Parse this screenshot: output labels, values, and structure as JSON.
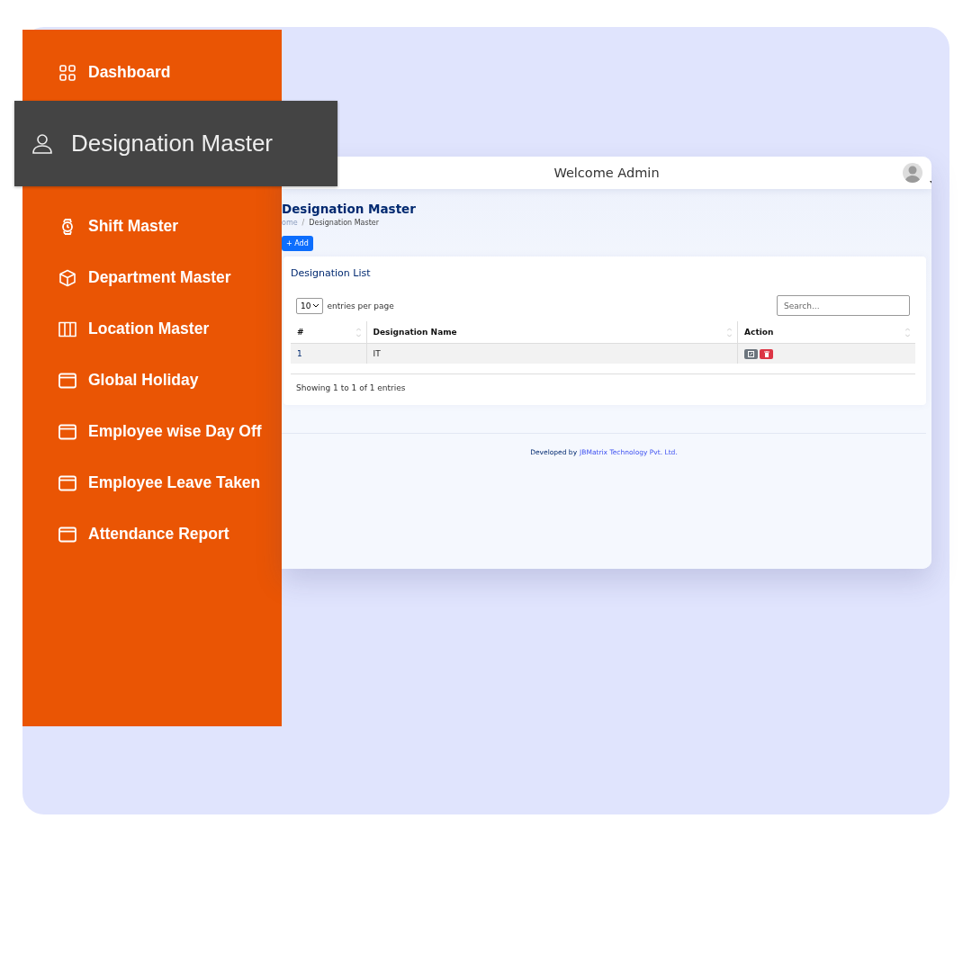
{
  "sidebar": {
    "items": [
      {
        "label": "Dashboard",
        "kind": "grid"
      },
      {
        "label": "Shift Master",
        "kind": "watch"
      },
      {
        "label": "Department Master",
        "kind": "box"
      },
      {
        "label": "Location Master",
        "kind": "map"
      },
      {
        "label": "Global Holiday",
        "kind": "calendar"
      },
      {
        "label": "Employee wise Day Off",
        "kind": "calendar"
      },
      {
        "label": "Employee Leave Taken",
        "kind": "calendar"
      },
      {
        "label": "Attendance Report",
        "kind": "calendar"
      }
    ]
  },
  "callout": {
    "label": "Designation Master",
    "kind": "user"
  },
  "topbar": {
    "title": "Welcome Admin"
  },
  "page": {
    "title": "Designation Master",
    "breadcrumb": [
      "ome",
      "Designation Master"
    ],
    "breadcrumb_separator": "/",
    "add_button": "+ Add"
  },
  "card": {
    "title": "Designation List",
    "page_size": "10",
    "page_size_label": "entries per page",
    "search": {
      "placeholder": "Search..."
    },
    "columns": [
      "#",
      "Designation Name",
      "Action"
    ],
    "rows": [
      {
        "cells": [
          "1",
          "IT"
        ]
      }
    ],
    "info": "Showing 1 to 1 of 1 entries"
  },
  "footer": {
    "text": "Developed by",
    "link": "JBMatrix Technology Pvt. Ltd."
  }
}
